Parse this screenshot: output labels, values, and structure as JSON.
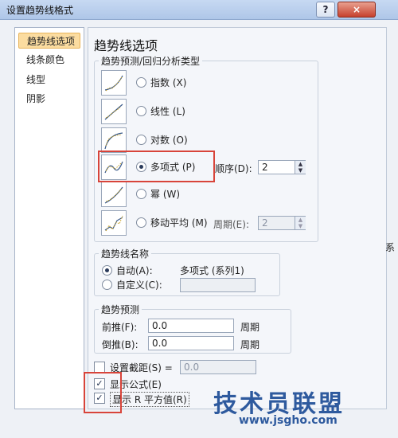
{
  "window": {
    "title": "设置趋势线格式",
    "help": "?",
    "close": "×"
  },
  "nav": [
    {
      "label": "趋势线选项",
      "selected": true
    },
    {
      "label": "线条颜色",
      "selected": false
    },
    {
      "label": "线型",
      "selected": false
    },
    {
      "label": "阴影",
      "selected": false
    }
  ],
  "main": {
    "title": "趋势线选项",
    "type_group": {
      "legend": "趋势预测/回归分析类型",
      "options": [
        {
          "label": "指数",
          "key": "(X)",
          "selected": false
        },
        {
          "label": "线性",
          "key": "(L)",
          "selected": false
        },
        {
          "label": "对数",
          "key": "(O)",
          "selected": false
        },
        {
          "label": "多项式",
          "key": "(P)",
          "selected": true
        },
        {
          "label": "幂",
          "key": "(W)",
          "selected": false
        },
        {
          "label": "移动平均",
          "key": "(M)",
          "selected": false
        }
      ],
      "order_label": "顺序(D):",
      "order_value": "2",
      "period_label": "周期(E):",
      "period_value": "2"
    },
    "name_group": {
      "legend": "趋势线名称",
      "auto_label": "自动(A):",
      "auto_value": "多项式 (系列1)",
      "custom_label": "自定义(C):",
      "custom_value": ""
    },
    "forecast_group": {
      "legend": "趋势预测",
      "forward_label": "前推(F):",
      "forward_value": "0.0",
      "backward_label": "倒推(B):",
      "backward_value": "0.0",
      "unit": "周期"
    },
    "intercept_label": "设置截距(S) =",
    "intercept_value": "0.0",
    "show_equation_label": "显示公式(E)",
    "show_equation": true,
    "show_r2_label": "显示 R 平方值(R)",
    "show_r2": true
  },
  "overlay": {
    "edge_text": "系",
    "watermark": "技术员联盟",
    "watermark_url": "www.jsgho.com"
  },
  "colors": {
    "highlight": "#d8443a",
    "selected_nav": "#fbdca0"
  }
}
